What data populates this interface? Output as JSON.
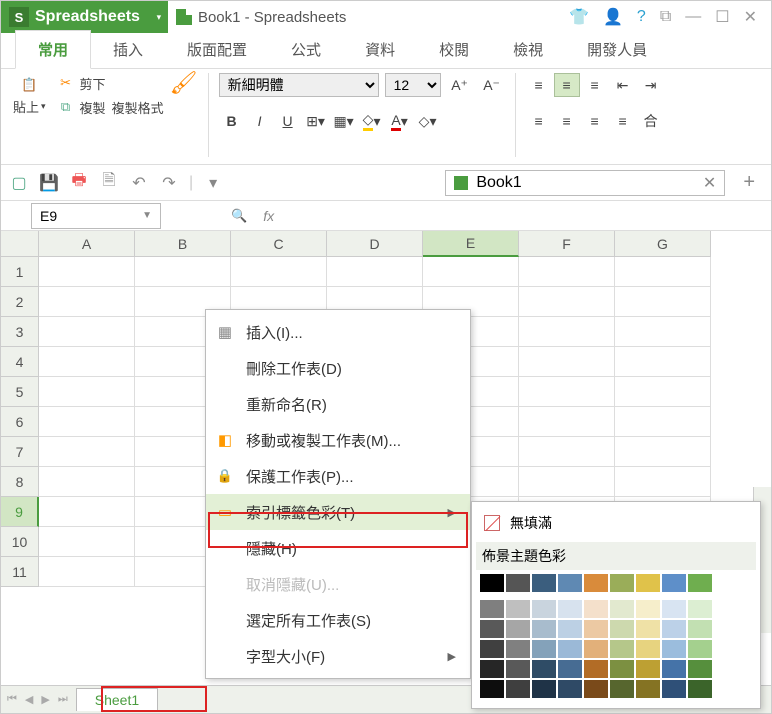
{
  "brand": "Spreadsheets",
  "window_title": "Book1 - Spreadsheets",
  "tabs": [
    "常用",
    "插入",
    "版面配置",
    "公式",
    "資料",
    "校閱",
    "檢視",
    "開發人員"
  ],
  "active_tab": 0,
  "clipboard": {
    "cut": "剪下",
    "copy": "複製",
    "format_painter": "複製格式",
    "paste": "貼上"
  },
  "font": {
    "name": "新細明體",
    "size": "12"
  },
  "doc_tab": {
    "name": "Book1"
  },
  "namebox": "E9",
  "columns": [
    "A",
    "B",
    "C",
    "D",
    "E",
    "F",
    "G"
  ],
  "selected_col_index": 4,
  "rows": [
    1,
    2,
    3,
    4,
    5,
    6,
    7,
    8,
    9,
    10,
    11
  ],
  "selected_row_index": 8,
  "sheet_tab": "Sheet1",
  "context_menu": {
    "insert": "插入(I)...",
    "delete": "刪除工作表(D)",
    "rename": "重新命名(R)",
    "move": "移動或複製工作表(M)...",
    "protect": "保護工作表(P)...",
    "tab_color": "索引標籤色彩(T)",
    "hide": "隱藏(H)",
    "unhide": "取消隱藏(U)...",
    "select_all": "選定所有工作表(S)",
    "font_size": "字型大小(F)"
  },
  "color_flyout": {
    "no_fill": "無填滿",
    "theme_header": "佈景主題色彩",
    "theme_row": [
      "#000000",
      "#555555",
      "#3b5e7e",
      "#5f89b3",
      "#d98b3b",
      "#9aad59",
      "#e0c24a",
      "#5e8fc9",
      "#6fae4f"
    ],
    "tint_rows": [
      [
        "#7f7f7f",
        "#bfbfbf",
        "#c9d4de",
        "#d7e2ee",
        "#f4e0cb",
        "#e2e9cf",
        "#f6eecb",
        "#d8e4f2",
        "#dceed2"
      ],
      [
        "#595959",
        "#a6a6a6",
        "#a8bccd",
        "#bcd0e4",
        "#ecc9a3",
        "#cdd9ae",
        "#efe1a6",
        "#bcd1e8",
        "#c2e0b2"
      ],
      [
        "#404040",
        "#808080",
        "#84a2ba",
        "#9bb9d7",
        "#e2b07a",
        "#b5c78a",
        "#e7d37f",
        "#9bbddd",
        "#a4d08e"
      ],
      [
        "#262626",
        "#595959",
        "#2f4c66",
        "#476c93",
        "#b26c26",
        "#7c9041",
        "#bda033",
        "#4573a8",
        "#568f3d"
      ],
      [
        "#0d0d0d",
        "#3f3f3f",
        "#1f3347",
        "#2f4a66",
        "#7a4a1a",
        "#57662e",
        "#857323",
        "#2f5078",
        "#3b642a"
      ]
    ]
  }
}
